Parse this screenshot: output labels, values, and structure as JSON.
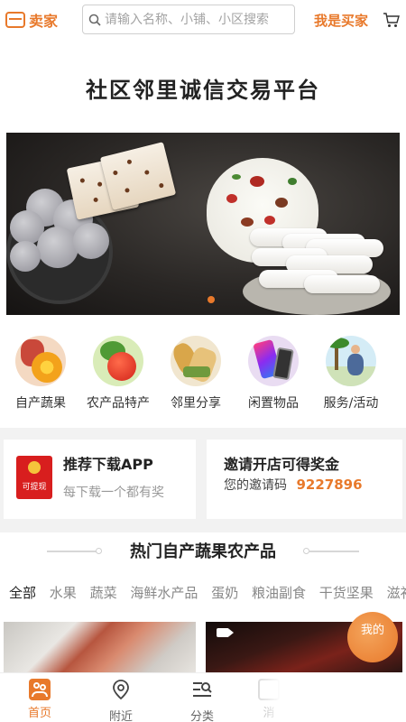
{
  "header": {
    "seller_label": "卖家",
    "search_placeholder": "请输入名称、小铺、小区搜索",
    "buyer_label": "我是买家"
  },
  "slogan": "社区邻里诚信交易平台",
  "categories": [
    {
      "label": "自产蔬果",
      "icon": "fruit-icon"
    },
    {
      "label": "农产品特产",
      "icon": "produce-icon"
    },
    {
      "label": "邻里分享",
      "icon": "share-icon"
    },
    {
      "label": "闲置物品",
      "icon": "idle-goods-icon"
    },
    {
      "label": "服务/活动",
      "icon": "service-icon"
    }
  ],
  "cards": {
    "app": {
      "badge": "可提现",
      "title": "推荐下载APP",
      "subtitle": "每下载一个都有奖"
    },
    "invite": {
      "title": "邀请开店可得奖金",
      "code_label": "您的邀请码",
      "code": "9227896"
    }
  },
  "section": {
    "title": "热门自产蔬果农产品",
    "tabs": [
      "全部",
      "水果",
      "蔬菜",
      "海鲜水产品",
      "蛋奶",
      "粮油副食",
      "干货坚果",
      "滋补"
    ],
    "active_tab": 0
  },
  "floating": {
    "mine_label": "我的"
  },
  "nav": [
    {
      "label": "首页",
      "icon": "home-icon",
      "active": true
    },
    {
      "label": "附近",
      "icon": "location-icon",
      "active": false
    },
    {
      "label": "分类",
      "icon": "category-icon",
      "active": false
    },
    {
      "label": "消",
      "icon": "message-icon",
      "active": false
    }
  ],
  "colors": {
    "accent": "#e8792b",
    "red_packet": "#d81e1e"
  }
}
